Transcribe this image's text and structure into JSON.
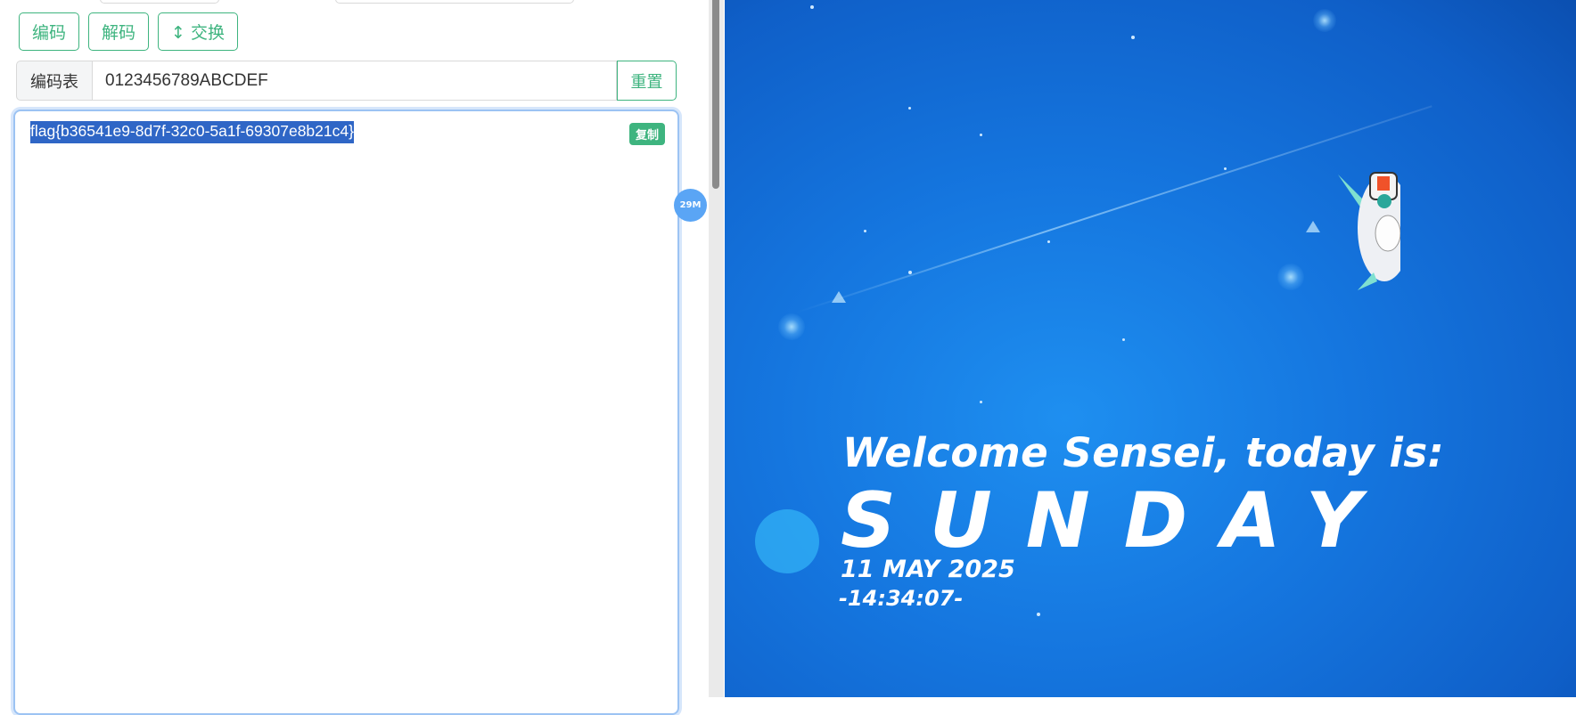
{
  "toolbar": {
    "encode_label": "编码",
    "decode_label": "解码",
    "swap_label": "↕ 交换"
  },
  "code_table": {
    "addon_label": "编码表",
    "value": "0123456789ABCDEF",
    "reset_label": "重置"
  },
  "output": {
    "text": "flag{b36541e9-8d7f-32c0-5a1f-69307e8b21c4}",
    "copy_label": "复制"
  },
  "float_badge": {
    "label": "29M"
  },
  "wallpaper": {
    "welcome": "Welcome Sensei, today is:",
    "day": "SUNDAY",
    "date": "11 MAY 2025",
    "time": "-14:34:07-"
  },
  "colors": {
    "accent_green": "#3eb47f",
    "selection_blue": "#2f66c6",
    "bubble_blue": "#5aa5f5",
    "wallpaper_blue": "#1576df"
  }
}
